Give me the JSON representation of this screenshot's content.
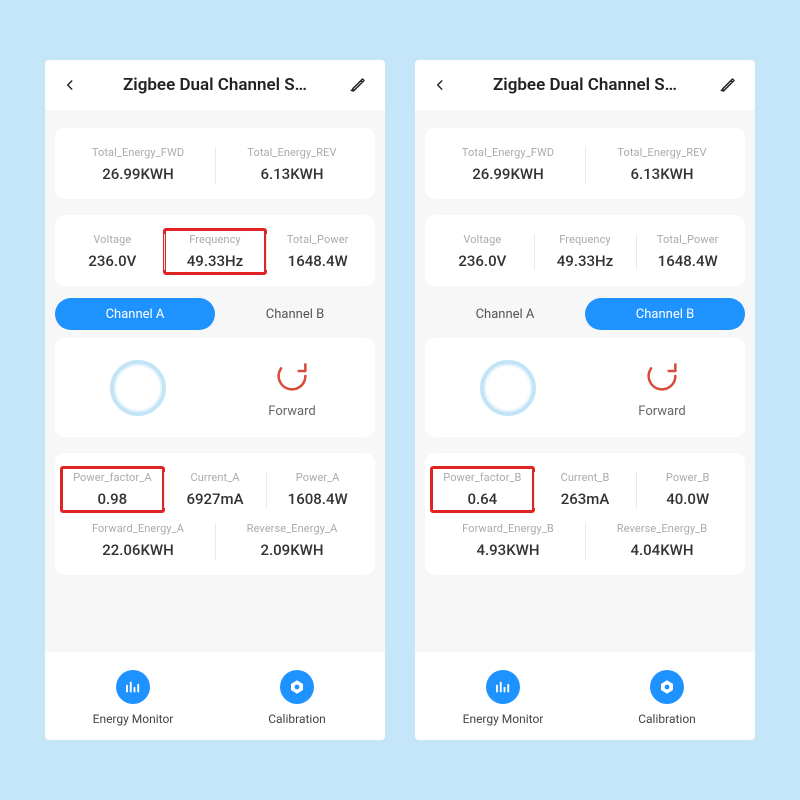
{
  "left": {
    "header": {
      "title": "Zigbee Dual Channel S…"
    },
    "top": {
      "total_fwd": {
        "label": "Total_Energy_FWD",
        "value": "26.99KWH"
      },
      "total_rev": {
        "label": "Total_Energy_REV",
        "value": "6.13KWH"
      }
    },
    "mid": {
      "voltage": {
        "label": "Voltage",
        "value": "236.0V"
      },
      "frequency": {
        "label": "Frequency",
        "value": "49.33Hz"
      },
      "power": {
        "label": "Total_Power",
        "value": "1648.4W"
      }
    },
    "tabs": {
      "a": "Channel A",
      "b": "Channel B",
      "active": "a",
      "forward": "Forward"
    },
    "channel": {
      "pf": {
        "label": "Power_factor_A",
        "value": "0.98"
      },
      "cur": {
        "label": "Current_A",
        "value": "6927mA"
      },
      "pow": {
        "label": "Power_A",
        "value": "1608.4W"
      },
      "fwd_e": {
        "label": "Forward_Energy_A",
        "value": "22.06KWH"
      },
      "rev_e": {
        "label": "Reverse_Energy_A",
        "value": "2.09KWH"
      }
    },
    "bottom": {
      "monitor": "Energy Monitor",
      "calib": "Calibration"
    }
  },
  "right": {
    "header": {
      "title": "Zigbee Dual Channel S…"
    },
    "top": {
      "total_fwd": {
        "label": "Total_Energy_FWD",
        "value": "26.99KWH"
      },
      "total_rev": {
        "label": "Total_Energy_REV",
        "value": "6.13KWH"
      }
    },
    "mid": {
      "voltage": {
        "label": "Voltage",
        "value": "236.0V"
      },
      "frequency": {
        "label": "Frequency",
        "value": "49.33Hz"
      },
      "power": {
        "label": "Total_Power",
        "value": "1648.4W"
      }
    },
    "tabs": {
      "a": "Channel A",
      "b": "Channel B",
      "active": "b",
      "forward": "Forward"
    },
    "channel": {
      "pf": {
        "label": "Power_factor_B",
        "value": "0.64"
      },
      "cur": {
        "label": "Current_B",
        "value": "263mA"
      },
      "pow": {
        "label": "Power_B",
        "value": "40.0W"
      },
      "fwd_e": {
        "label": "Forward_Energy_B",
        "value": "4.93KWH"
      },
      "rev_e": {
        "label": "Reverse_Energy_B",
        "value": "4.04KWH"
      }
    },
    "bottom": {
      "monitor": "Energy Monitor",
      "calib": "Calibration"
    }
  },
  "colors": {
    "accent": "#1E93FF",
    "highlight": "#E02424"
  }
}
